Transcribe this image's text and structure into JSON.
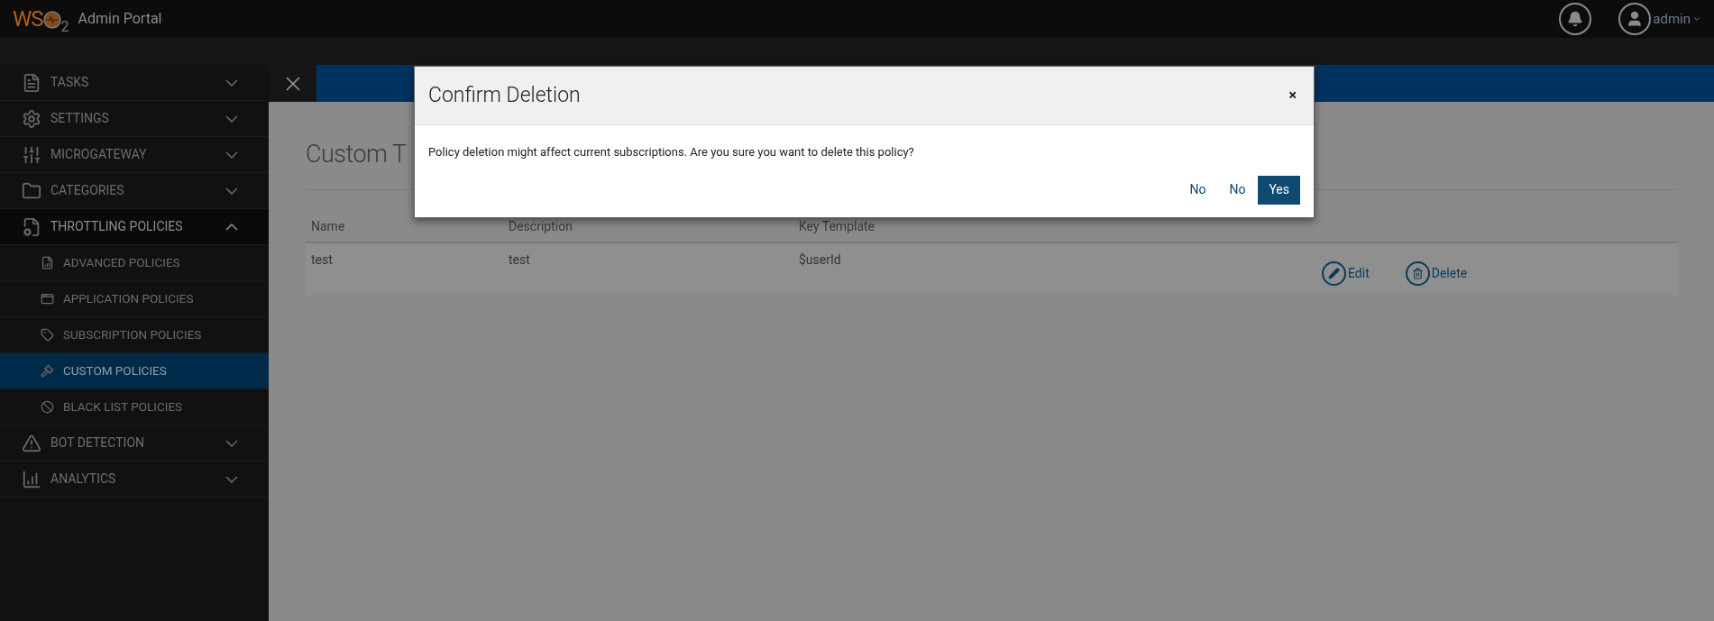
{
  "header": {
    "logo": {
      "letters": "WS",
      "sub": "2"
    },
    "title": "Admin Portal",
    "user": "admin"
  },
  "sidebar": {
    "items": [
      {
        "label": "TASKS",
        "expanded": false
      },
      {
        "label": "SETTINGS",
        "expanded": false
      },
      {
        "label": "MICROGATEWAY",
        "expanded": false
      },
      {
        "label": "CATEGORIES",
        "expanded": false
      },
      {
        "label": "THROTTLING POLICIES",
        "expanded": true,
        "children": [
          {
            "label": "ADVANCED POLICIES",
            "selected": false
          },
          {
            "label": "APPLICATION POLICIES",
            "selected": false
          },
          {
            "label": "SUBSCRIPTION POLICIES",
            "selected": false
          },
          {
            "label": "CUSTOM POLICIES",
            "selected": true
          },
          {
            "label": "BLACK LIST POLICIES",
            "selected": false
          }
        ]
      },
      {
        "label": "BOT DETECTION",
        "expanded": false
      },
      {
        "label": "ANALYTICS",
        "expanded": false
      }
    ]
  },
  "page": {
    "title": "Custom T",
    "table": {
      "columns": [
        "Name",
        "Description",
        "Key Template"
      ],
      "rows": [
        {
          "cells": [
            "test",
            "test",
            "$userId"
          ],
          "actions": [
            "Edit",
            "Delete"
          ]
        }
      ]
    }
  },
  "dialog": {
    "title": "Confirm Deletion",
    "close": "×",
    "message": "Policy deletion might affect current subscriptions. Are you sure you want to delete this policy?",
    "buttons": [
      {
        "label": "No",
        "primary": false
      },
      {
        "label": "No",
        "primary": false
      },
      {
        "label": "Yes",
        "primary": true
      }
    ]
  }
}
